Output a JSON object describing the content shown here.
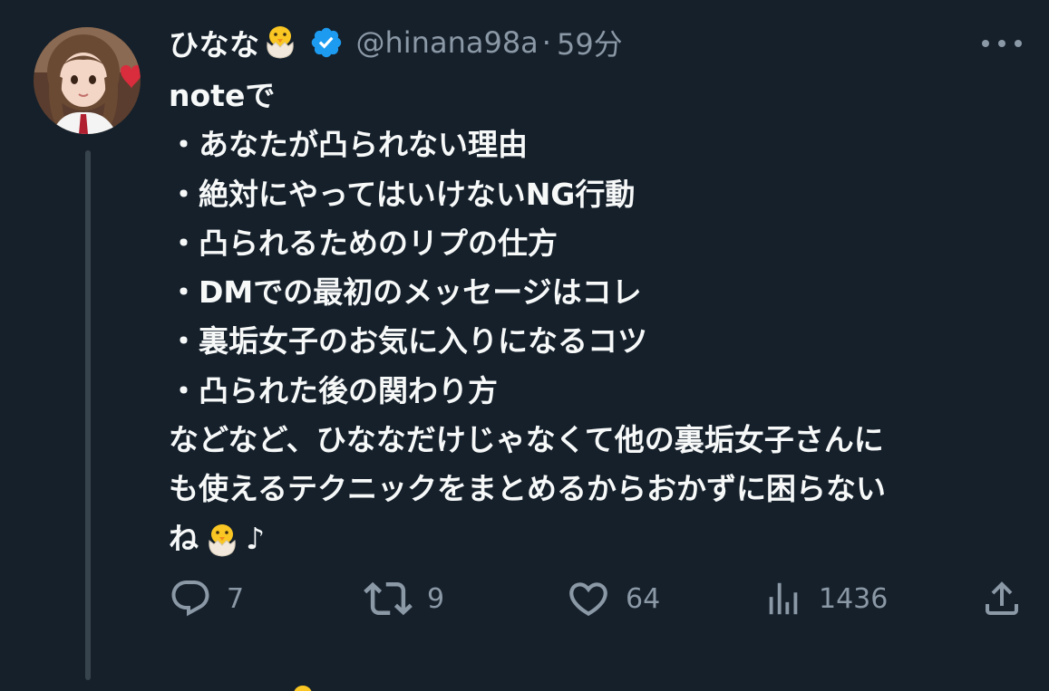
{
  "author": {
    "display_name": "ひなな",
    "handle": "@hinana98a",
    "separator": "·",
    "time": "59分",
    "verified": true
  },
  "tweet": {
    "lines": [
      "noteで",
      "・あなたが凸られない理由",
      "・絶対にやってはいけないNG行動",
      "・凸られるためのリプの仕方",
      "・DMでの最初のメッセージはコレ",
      "・裏垢女子のお気に入りになるコツ",
      "・凸られた後の関わり方",
      "などなど、ひななだけじゃなくて他の裏垢女子さんに",
      "も使えるテクニックをまとめるからおかずに困らない"
    ],
    "last_line_start": "ね",
    "last_line_end": "♪"
  },
  "actions": {
    "replies": "7",
    "retweets": "9",
    "likes": "64",
    "views": "1436"
  },
  "icons": {
    "more": "more-icon",
    "reply": "reply-icon",
    "retweet": "retweet-icon",
    "like": "heart-icon",
    "views": "views-icon",
    "share": "share-icon",
    "verified": "verified-badge-icon",
    "emoji": "hatching-chick-emoji"
  },
  "colors": {
    "background": "#15202b",
    "text": "#f7f9f9",
    "secondary": "#8b98a5",
    "verified": "#1d9bf0",
    "thread_line": "#38444d"
  }
}
